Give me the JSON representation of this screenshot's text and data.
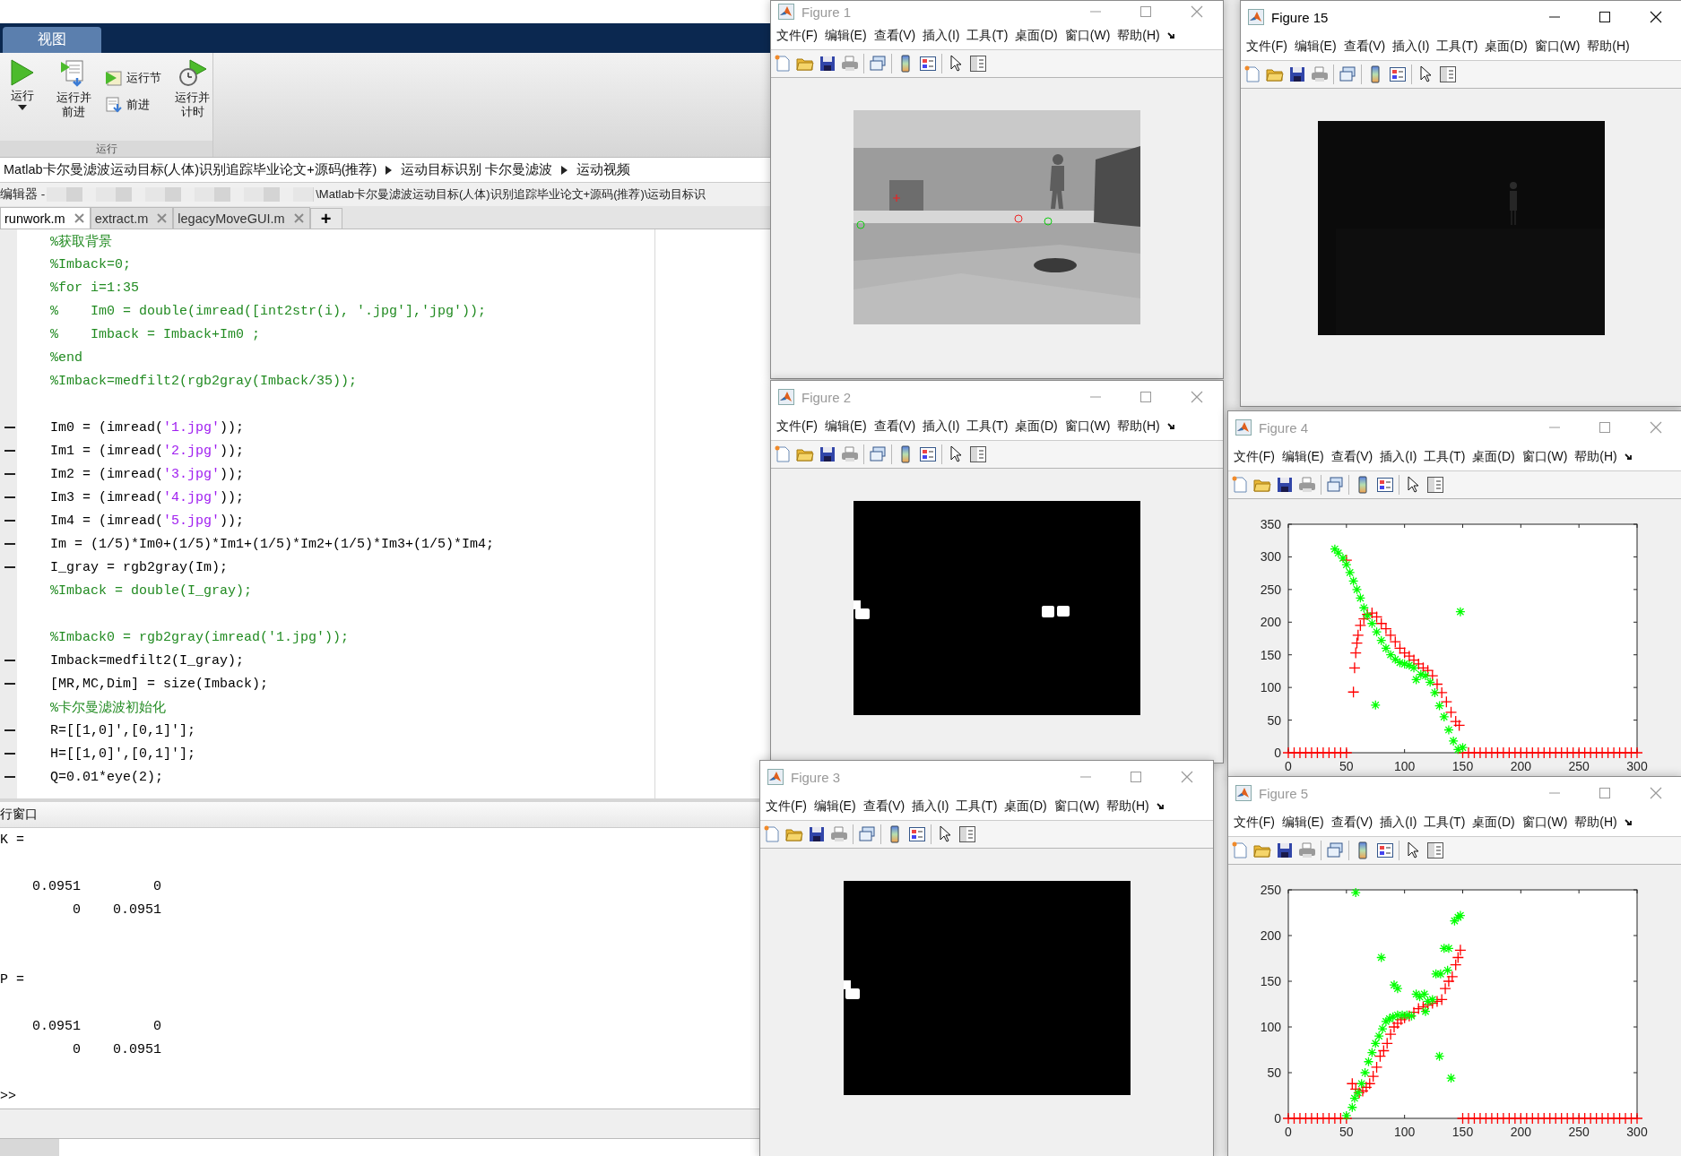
{
  "main_window": {
    "ribbon_tab": {
      "label": "视图",
      "selected": true
    },
    "run_group": {
      "label": "运行",
      "buttons": [
        {
          "kind": "large",
          "label": "运行",
          "dropdown": true
        },
        {
          "kind": "large",
          "label": "运行并前进",
          "dropdown": false
        },
        {
          "kind": "small",
          "label": "运行节"
        },
        {
          "kind": "small",
          "label": "前进"
        },
        {
          "kind": "large",
          "label": "运行并计时",
          "dropdown": false
        }
      ]
    },
    "breadcrumb": [
      "Matlab卡尔曼滤波运动目标(人体)识别追踪毕业论文+源码(推荐)",
      "运动目标识别 卡尔曼滤波",
      "运动视频"
    ],
    "editor": {
      "title_prefix": "编辑器 -",
      "title_path": "\\Matlab卡尔曼滤波运动目标(人体)识别追踪毕业论文+源码(推荐)\\运动目标识",
      "tabs": [
        {
          "label": "runwork.m",
          "selected": true
        },
        {
          "label": "extract.m",
          "selected": false
        },
        {
          "label": "legacyMoveGUI.m",
          "selected": false
        }
      ],
      "new_tab_label": "+",
      "lines": [
        {
          "kind": "code",
          "segments": [
            {
              "kind": "comment",
              "text": "%获取背景"
            }
          ]
        },
        {
          "kind": "code",
          "segments": [
            {
              "kind": "comment",
              "text": "%Imback=0;"
            }
          ]
        },
        {
          "kind": "code",
          "segments": [
            {
              "kind": "comment",
              "text": "%for i=1:35"
            }
          ]
        },
        {
          "kind": "code",
          "segments": [
            {
              "kind": "comment",
              "text": "%    Im0 = double(imread([int2str(i), '.jpg'],'jpg'));"
            }
          ]
        },
        {
          "kind": "code",
          "segments": [
            {
              "kind": "comment",
              "text": "%    Imback = Imback+Im0 ;"
            }
          ]
        },
        {
          "kind": "code",
          "segments": [
            {
              "kind": "comment",
              "text": "%end"
            }
          ]
        },
        {
          "kind": "code",
          "segments": [
            {
              "kind": "comment",
              "text": "%Imback=medfilt2(rgb2gray(Imback/35));"
            }
          ]
        },
        {
          "kind": "blank"
        },
        {
          "kind": "code",
          "executable": true,
          "segments": [
            {
              "kind": "plain",
              "text": "Im0 = (imread("
            },
            {
              "kind": "string",
              "text": "'1.jpg'"
            },
            {
              "kind": "plain",
              "text": "));"
            }
          ]
        },
        {
          "kind": "code",
          "executable": true,
          "segments": [
            {
              "kind": "plain",
              "text": "Im1 = (imread("
            },
            {
              "kind": "string",
              "text": "'2.jpg'"
            },
            {
              "kind": "plain",
              "text": "));"
            }
          ]
        },
        {
          "kind": "code",
          "executable": true,
          "segments": [
            {
              "kind": "plain",
              "text": "Im2 = (imread("
            },
            {
              "kind": "string",
              "text": "'3.jpg'"
            },
            {
              "kind": "plain",
              "text": "));"
            }
          ]
        },
        {
          "kind": "code",
          "executable": true,
          "segments": [
            {
              "kind": "plain",
              "text": "Im3 = (imread("
            },
            {
              "kind": "string",
              "text": "'4.jpg'"
            },
            {
              "kind": "plain",
              "text": "));"
            }
          ]
        },
        {
          "kind": "code",
          "executable": true,
          "segments": [
            {
              "kind": "plain",
              "text": "Im4 = (imread("
            },
            {
              "kind": "string",
              "text": "'5.jpg'"
            },
            {
              "kind": "plain",
              "text": "));"
            }
          ]
        },
        {
          "kind": "code",
          "executable": true,
          "segments": [
            {
              "kind": "plain",
              "text": "Im = (1/5)*Im0+(1/5)*Im1+(1/5)*Im2+(1/5)*Im3+(1/5)*Im4;"
            }
          ]
        },
        {
          "kind": "code",
          "executable": true,
          "segments": [
            {
              "kind": "plain",
              "text": "I_gray = rgb2gray(Im);"
            }
          ]
        },
        {
          "kind": "code",
          "segments": [
            {
              "kind": "comment",
              "text": "%Imback = double(I_gray);"
            }
          ]
        },
        {
          "kind": "blank"
        },
        {
          "kind": "code",
          "segments": [
            {
              "kind": "comment",
              "text": "%Imback0 = rgb2gray(imread('1.jpg'));"
            }
          ]
        },
        {
          "kind": "code",
          "executable": true,
          "segments": [
            {
              "kind": "plain",
              "text": "Imback=medfilt2(I_gray);"
            }
          ]
        },
        {
          "kind": "code",
          "executable": true,
          "segments": [
            {
              "kind": "plain",
              "text": "[MR,MC,Dim] = size(Imback);"
            }
          ]
        },
        {
          "kind": "code",
          "segments": [
            {
              "kind": "comment",
              "text": "%卡尔曼滤波初始化"
            }
          ]
        },
        {
          "kind": "code",
          "executable": true,
          "segments": [
            {
              "kind": "plain",
              "text": "R=[[1,0]',[0,1]'];"
            }
          ]
        },
        {
          "kind": "code",
          "executable": true,
          "segments": [
            {
              "kind": "plain",
              "text": "H=[[1,0]',[0,1]'];"
            }
          ]
        },
        {
          "kind": "code",
          "executable": true,
          "segments": [
            {
              "kind": "plain",
              "text": "Q=0.01*eye(2);"
            }
          ]
        }
      ]
    },
    "command_window": {
      "title": "行窗口",
      "lines": [
        {
          "kind": "text",
          "text": "K ="
        },
        {
          "kind": "blank"
        },
        {
          "kind": "text",
          "text": "    0.0951         0"
        },
        {
          "kind": "text",
          "text": "         0    0.0951"
        },
        {
          "kind": "blank"
        },
        {
          "kind": "blank"
        },
        {
          "kind": "text",
          "text": "P ="
        },
        {
          "kind": "blank"
        },
        {
          "kind": "text",
          "text": "    0.0951         0"
        },
        {
          "kind": "text",
          "text": "         0    0.0951"
        },
        {
          "kind": "blank"
        },
        {
          "kind": "text",
          "text": ">>"
        }
      ]
    }
  },
  "figures": [
    {
      "title": "Figure 1",
      "active": false,
      "menu_overflow_arrow": true,
      "menu": [
        "文件(F)",
        "编辑(E)",
        "查看(V)",
        "插入(I)",
        "工具(T)",
        "桌面(D)",
        "窗口(W)",
        "帮助(H)"
      ]
    },
    {
      "title": "Figure 15",
      "active": true,
      "menu_overflow_arrow": false,
      "menu": [
        "文件(F)",
        "编辑(E)",
        "查看(V)",
        "插入(I)",
        "工具(T)",
        "桌面(D)",
        "窗口(W)",
        "帮助(H)"
      ]
    },
    {
      "title": "Figure 2",
      "active": false,
      "menu_overflow_arrow": true,
      "menu": [
        "文件(F)",
        "编辑(E)",
        "查看(V)",
        "插入(I)",
        "工具(T)",
        "桌面(D)",
        "窗口(W)",
        "帮助(H)"
      ]
    },
    {
      "title": "Figure 4",
      "active": false,
      "menu_overflow_arrow": true,
      "menu": [
        "文件(F)",
        "编辑(E)",
        "查看(V)",
        "插入(I)",
        "工具(T)",
        "桌面(D)",
        "窗口(W)",
        "帮助(H)"
      ],
      "content": {
        "kind": "chart",
        "chart_data": {
          "type": "scatter",
          "xlim": [
            0,
            300
          ],
          "ylim": [
            0,
            350
          ],
          "xticks": [
            {
              "value": 0,
              "label": "0"
            },
            {
              "value": 50,
              "label": "50"
            },
            {
              "value": 100,
              "label": "100"
            },
            {
              "value": 150,
              "label": "150"
            },
            {
              "value": 200,
              "label": "200"
            },
            {
              "value": 250,
              "label": "250"
            },
            {
              "value": 300,
              "label": "300"
            }
          ],
          "yticks": [
            {
              "value": 0,
              "label": "0"
            },
            {
              "value": 50,
              "label": "50"
            },
            {
              "value": 100,
              "label": "100"
            },
            {
              "value": 150,
              "label": "150"
            },
            {
              "value": 200,
              "label": "200"
            },
            {
              "value": 250,
              "label": "250"
            },
            {
              "value": 300,
              "label": "300"
            },
            {
              "value": 350,
              "label": "350"
            }
          ],
          "series": [
            {
              "marker": "plus",
              "color": "#ff0000",
              "x": [
                0,
                5,
                10,
                15,
                20,
                25,
                30,
                35,
                40,
                45,
                50,
                50,
                56,
                57,
                58,
                59,
                60,
                62,
                65,
                68,
                72,
                76,
                80,
                84,
                88,
                92,
                96,
                100,
                104,
                108,
                112,
                116,
                120,
                124,
                128,
                132,
                136,
                140,
                144,
                147,
                150,
                155,
                160,
                165,
                170,
                175,
                180,
                185,
                190,
                195,
                200,
                205,
                210,
                215,
                220,
                225,
                230,
                235,
                240,
                245,
                250,
                255,
                260,
                265,
                270,
                275,
                280,
                285,
                290,
                295,
                300
              ],
              "values": [
                0,
                0,
                0,
                0,
                0,
                0,
                0,
                0,
                0,
                0,
                0,
                295,
                93,
                130,
                153,
                168,
                180,
                195,
                205,
                212,
                214,
                208,
                198,
                190,
                180,
                170,
                160,
                153,
                148,
                142,
                136,
                130,
                126,
                118,
                105,
                92,
                78,
                62,
                48,
                42,
                0,
                0,
                0,
                0,
                0,
                0,
                0,
                0,
                0,
                0,
                0,
                0,
                0,
                0,
                0,
                0,
                0,
                0,
                0,
                0,
                0,
                0,
                0,
                0,
                0,
                0,
                0,
                0,
                0,
                0,
                0
              ]
            },
            {
              "marker": "cross",
              "color": "#00ff00",
              "x": [
                40,
                43,
                47,
                50,
                53,
                56,
                59,
                62,
                65,
                68,
                72,
                76,
                80,
                84,
                88,
                92,
                96,
                100,
                104,
                108,
                110,
                114,
                118,
                122,
                126,
                130,
                134,
                138,
                142,
                146,
                150,
                148,
                75
              ],
              "values": [
                312,
                306,
                298,
                288,
                276,
                263,
                250,
                237,
                222,
                210,
                198,
                185,
                172,
                160,
                150,
                143,
                138,
                136,
                134,
                130,
                112,
                120,
                118,
                108,
                92,
                72,
                55,
                35,
                18,
                5,
                8,
                216,
                73
              ]
            }
          ]
        }
      }
    },
    {
      "title": "Figure 3",
      "active": false,
      "menu_overflow_arrow": true,
      "menu": [
        "文件(F)",
        "编辑(E)",
        "查看(V)",
        "插入(I)",
        "工具(T)",
        "桌面(D)",
        "窗口(W)",
        "帮助(H)"
      ]
    },
    {
      "title": "Figure 5",
      "active": false,
      "menu_overflow_arrow": true,
      "menu": [
        "文件(F)",
        "编辑(E)",
        "查看(V)",
        "插入(I)",
        "工具(T)",
        "桌面(D)",
        "窗口(W)",
        "帮助(H)"
      ],
      "content": {
        "kind": "chart",
        "chart_data": {
          "type": "scatter",
          "xlim": [
            0,
            300
          ],
          "ylim": [
            0,
            250
          ],
          "xticks": [
            {
              "value": 0,
              "label": "0"
            },
            {
              "value": 50,
              "label": "50"
            },
            {
              "value": 100,
              "label": "100"
            },
            {
              "value": 150,
              "label": "150"
            },
            {
              "value": 200,
              "label": "200"
            },
            {
              "value": 250,
              "label": "250"
            },
            {
              "value": 300,
              "label": "300"
            }
          ],
          "yticks": [
            {
              "value": 0,
              "label": "0"
            },
            {
              "value": 50,
              "label": "50"
            },
            {
              "value": 100,
              "label": "100"
            },
            {
              "value": 150,
              "label": "150"
            },
            {
              "value": 200,
              "label": "200"
            },
            {
              "value": 250,
              "label": "250"
            }
          ],
          "series": [
            {
              "marker": "plus",
              "color": "#ff0000",
              "x": [
                0,
                5,
                10,
                15,
                20,
                25,
                30,
                35,
                40,
                45,
                50,
                55,
                58,
                61,
                64,
                67,
                70,
                73,
                76,
                79,
                82,
                85,
                88,
                91,
                94,
                97,
                100,
                104,
                108,
                112,
                116,
                120,
                124,
                128,
                132,
                135,
                138,
                141,
                144,
                146,
                148,
                150,
                155,
                160,
                165,
                170,
                175,
                180,
                185,
                190,
                195,
                200,
                205,
                210,
                215,
                220,
                225,
                230,
                235,
                240,
                245,
                250,
                255,
                260,
                265,
                270,
                275,
                280,
                285,
                290,
                295,
                300
              ],
              "values": [
                0,
                0,
                0,
                0,
                0,
                0,
                0,
                0,
                0,
                0,
                0,
                38,
                32,
                28,
                30,
                34,
                38,
                46,
                56,
                68,
                74,
                82,
                92,
                100,
                104,
                108,
                110,
                112,
                116,
                120,
                122,
                124,
                126,
                128,
                130,
                142,
                150,
                155,
                168,
                176,
                184,
                0,
                0,
                0,
                0,
                0,
                0,
                0,
                0,
                0,
                0,
                0,
                0,
                0,
                0,
                0,
                0,
                0,
                0,
                0,
                0,
                0,
                0,
                0,
                0,
                0,
                0,
                0,
                0,
                0,
                0,
                0
              ]
            },
            {
              "marker": "cross",
              "color": "#00ff00",
              "x": [
                50,
                55,
                57,
                60,
                63,
                66,
                69,
                72,
                75,
                78,
                81,
                84,
                87,
                90,
                94,
                98,
                102,
                106,
                110,
                113,
                117,
                120,
                124,
                127,
                131,
                130,
                134,
                138,
                137,
                140,
                143,
                146,
                148,
                58,
                80,
                91,
                94,
                118
              ],
              "values": [
                3,
                12,
                22,
                28,
                38,
                50,
                62,
                72,
                82,
                90,
                98,
                106,
                109,
                111,
                113,
                113,
                113,
                112,
                136,
                133,
                136,
                128,
                130,
                158,
                158,
                68,
                186,
                186,
                162,
                44,
                216,
                220,
                222,
                247,
                176,
                146,
                142,
                117
              ]
            }
          ]
        }
      }
    }
  ]
}
